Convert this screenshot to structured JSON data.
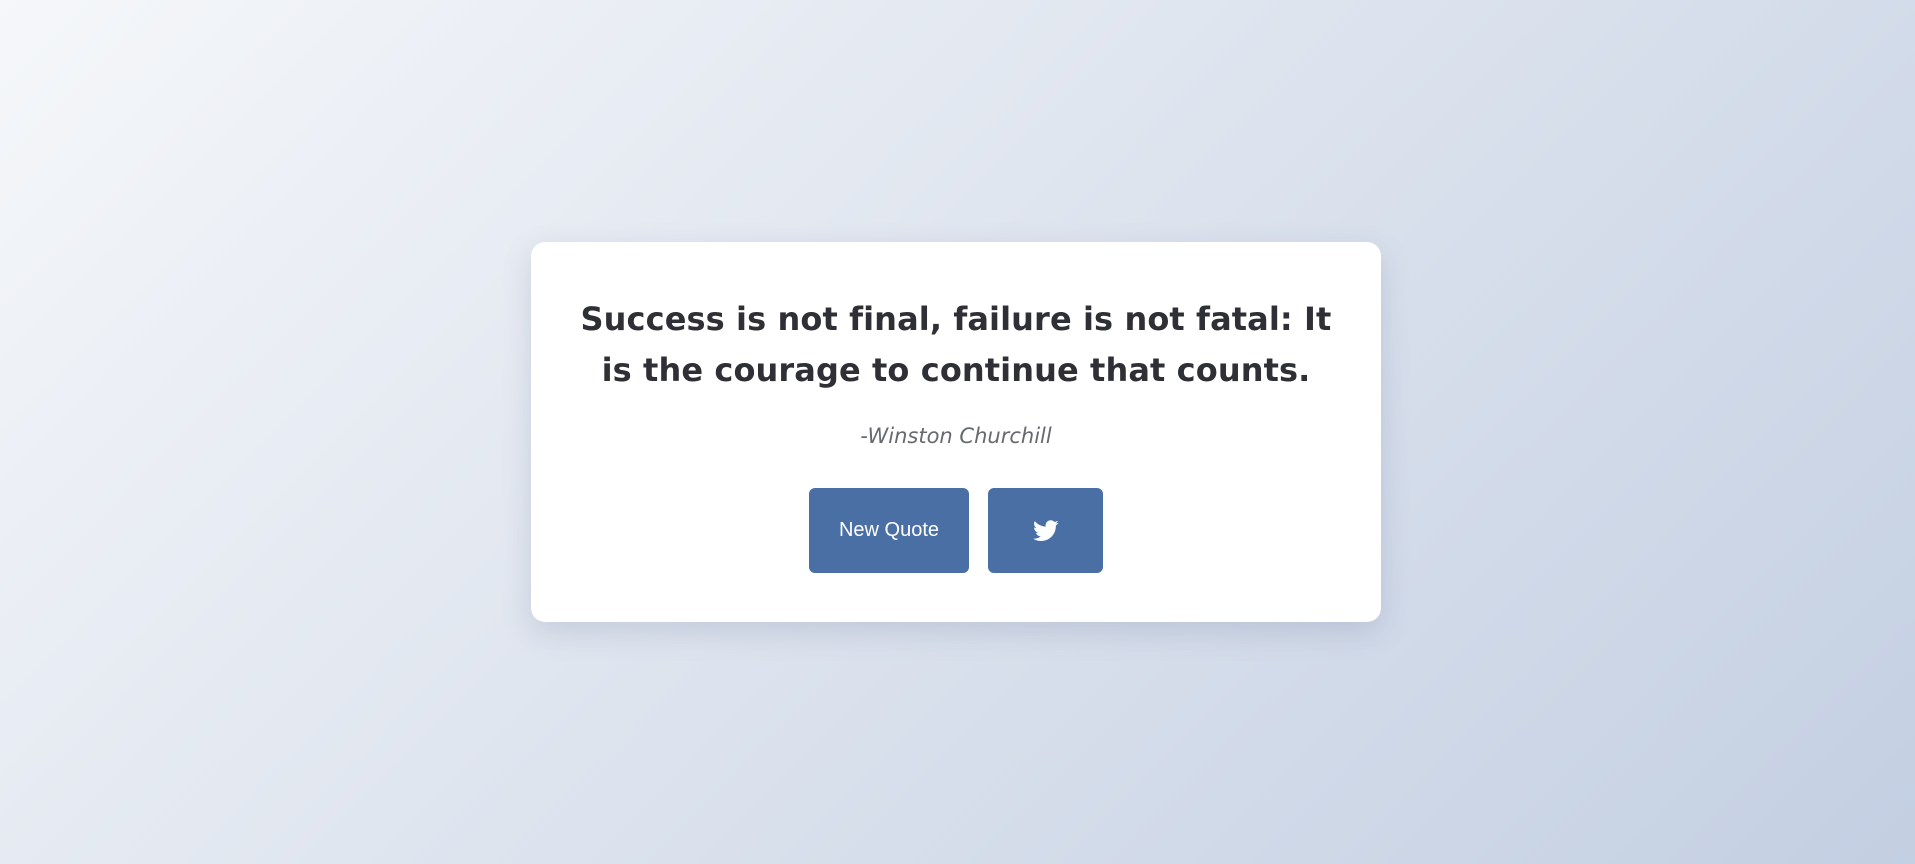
{
  "quote": {
    "text": "Success is not final, failure is not fatal: It is the courage to continue that counts.",
    "author": "-Winston Churchill"
  },
  "actions": {
    "new_quote_label": "New Quote",
    "tweet_icon": "twitter-icon"
  },
  "colors": {
    "button": "#4a6fa5",
    "card": "#ffffff",
    "text": "#2e3035",
    "author": "#666a70"
  }
}
